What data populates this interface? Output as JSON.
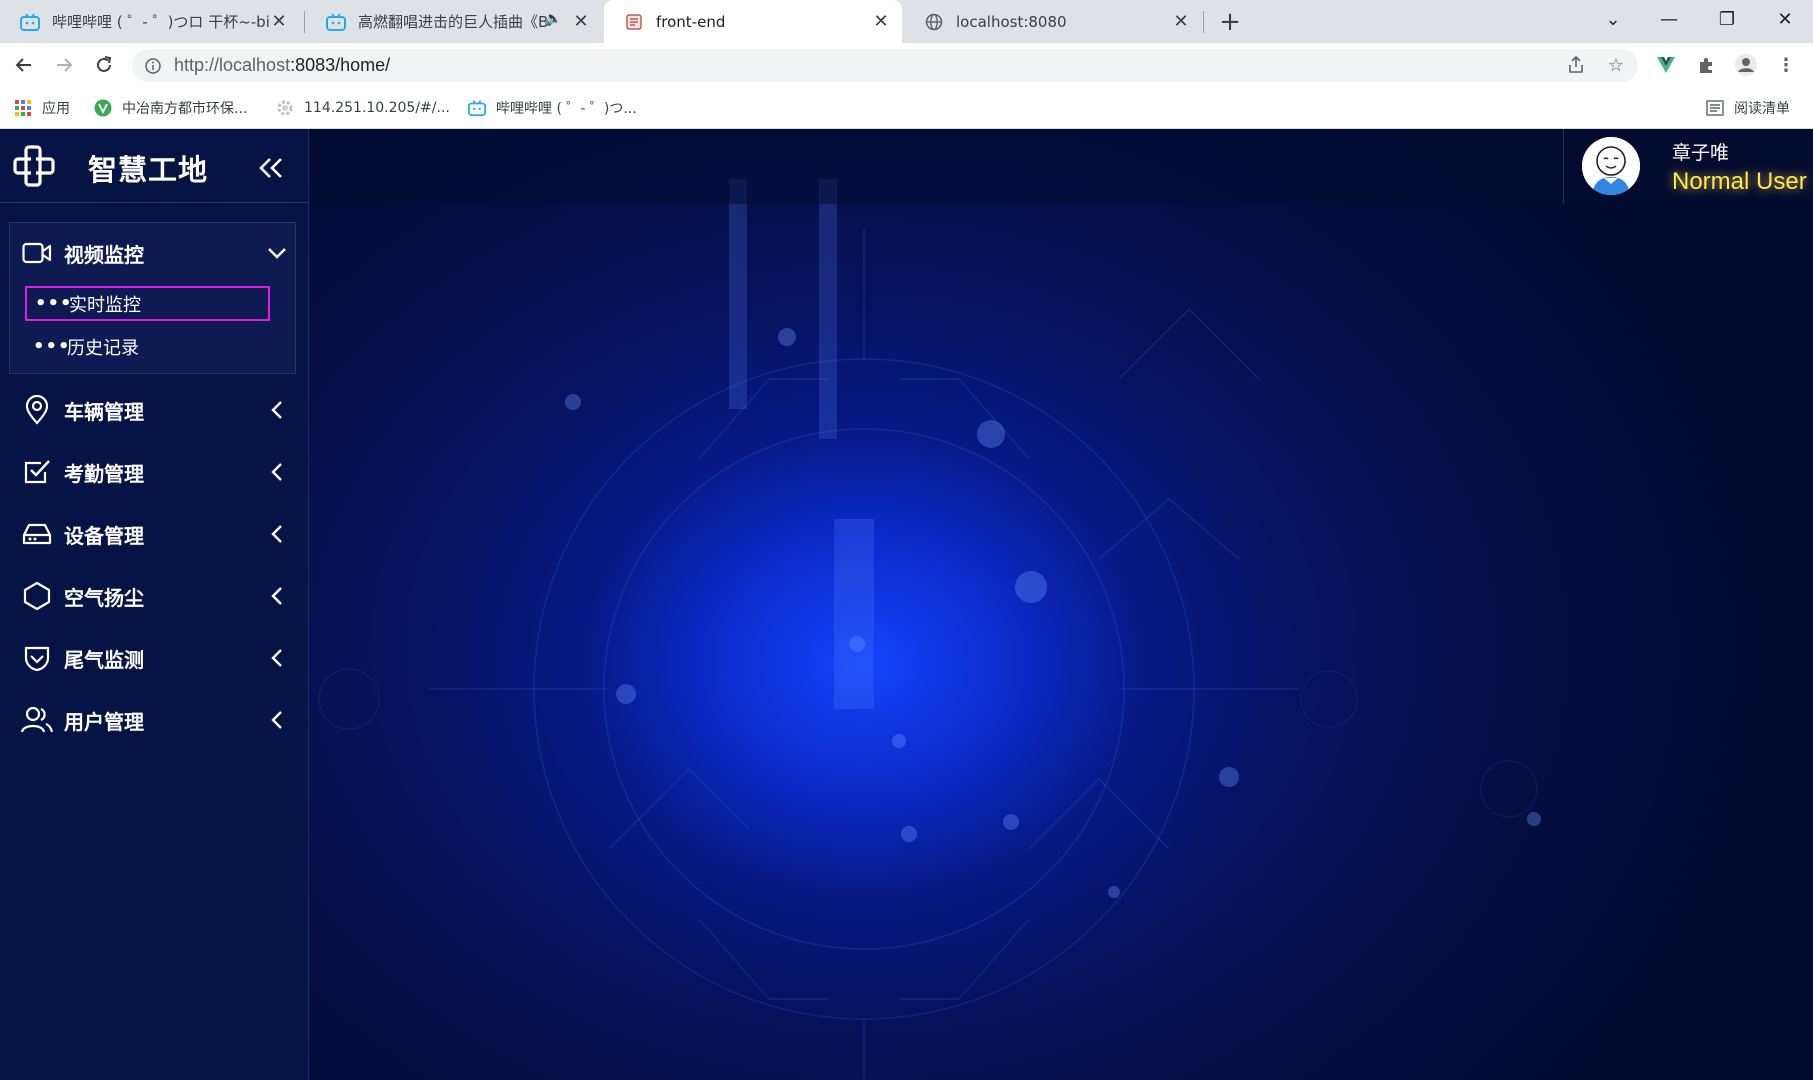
{
  "browser": {
    "tabs": [
      {
        "title": "哔哩哔哩 ( ゜- ゜)つロ 干杯~-bilil",
        "favicon": "bilibili-icon",
        "active": false
      },
      {
        "title": "高燃翻唱进击的巨人插曲《B",
        "favicon": "bilibili-icon",
        "active": false,
        "audio": true
      },
      {
        "title": "front-end",
        "favicon": "page-icon",
        "active": true
      },
      {
        "title": "localhost:8080",
        "favicon": "globe-icon",
        "active": false
      }
    ],
    "url_host": "http://localhost",
    "url_rest": ":8083/home/",
    "bookmarks": [
      {
        "label": "应用",
        "icon": "apps-grid-icon"
      },
      {
        "label": "中冶南方都市环保...",
        "icon": "vue-icon"
      },
      {
        "label": "114.251.10.205/#/...",
        "icon": "gear-icon"
      },
      {
        "label": "哔哩哔哩 ( ゜- ゜)つ...",
        "icon": "bilibili-icon"
      }
    ],
    "reading_list": "阅读清单"
  },
  "app": {
    "brand": "智慧工地",
    "menu": [
      {
        "label": "视频监控",
        "icon": "video-camera-icon",
        "expanded": true,
        "children": [
          {
            "label": "实时监控",
            "selected": true
          },
          {
            "label": "历史记录",
            "selected": false
          }
        ]
      },
      {
        "label": "车辆管理",
        "icon": "location-pin-icon"
      },
      {
        "label": "考勤管理",
        "icon": "checkbox-icon"
      },
      {
        "label": "设备管理",
        "icon": "drive-icon"
      },
      {
        "label": "空气扬尘",
        "icon": "hexagon-icon"
      },
      {
        "label": "尾气监测",
        "icon": "shield-check-icon"
      },
      {
        "label": "用户管理",
        "icon": "users-icon"
      }
    ],
    "user": {
      "name": "章子唯",
      "role": "Normal User"
    },
    "colors": {
      "sidebar": "#051345",
      "accent_role": "#ffe74a",
      "selection_border": "#e21ae6"
    }
  }
}
